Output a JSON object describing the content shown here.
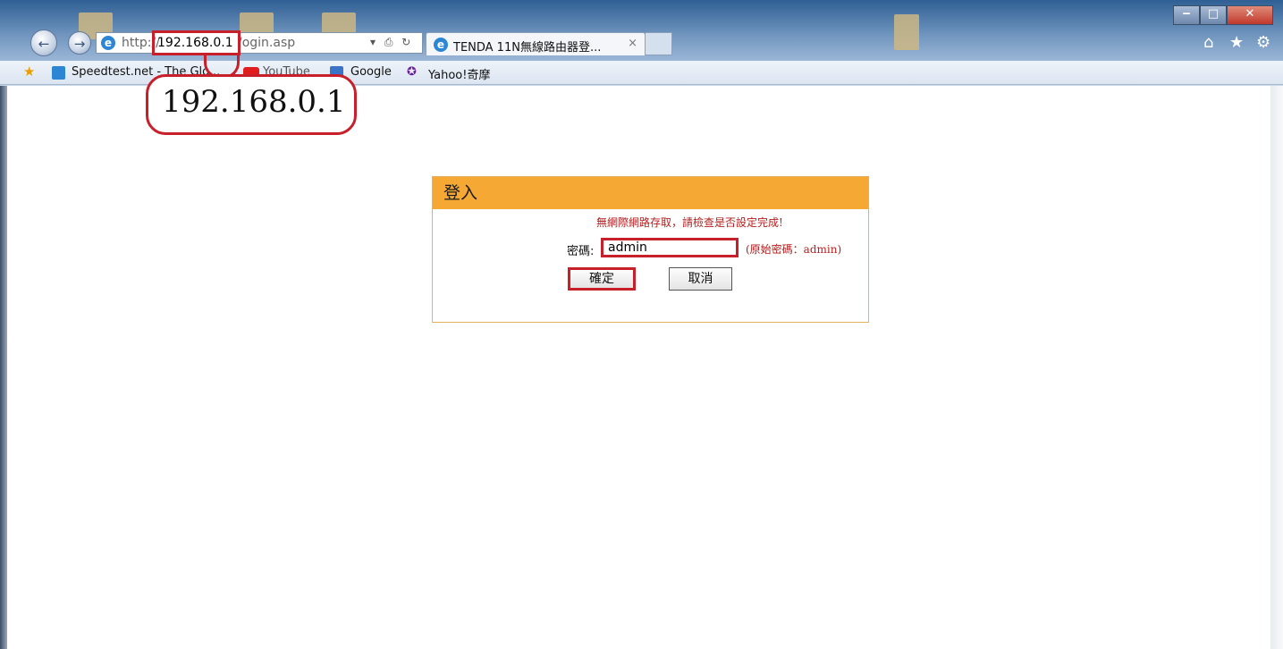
{
  "browser": {
    "address": {
      "scheme": "http://",
      "host": "192.168.0.1",
      "path": "/ogin.asp"
    },
    "tab": {
      "title": "TENDA 11N無線路由器登...",
      "close": "×"
    },
    "favorites": [
      {
        "label": "Speedtest.net - The Glo..."
      },
      {
        "label": "YouTube"
      },
      {
        "label": "Google"
      },
      {
        "label": "Yahoo!奇摩"
      }
    ],
    "window_controls": {
      "minimize": "‒",
      "maximize": "□",
      "close": "✕"
    },
    "toolbar_icons": {
      "home": "⌂",
      "favorites": "★",
      "settings": "⚙"
    }
  },
  "annotation": {
    "ip_callout": "192.168.0.1"
  },
  "login": {
    "title": "登入",
    "message": "無網際網路存取，請檢查是否設定完成!",
    "password_label": "密碼:",
    "password_value": "admin",
    "password_hint": "(原始密碼：admin)",
    "ok_label": "確定",
    "cancel_label": "取消"
  },
  "colors": {
    "header": "#f5a833",
    "annotation_red": "#c8202b",
    "message_red": "#b52020"
  }
}
